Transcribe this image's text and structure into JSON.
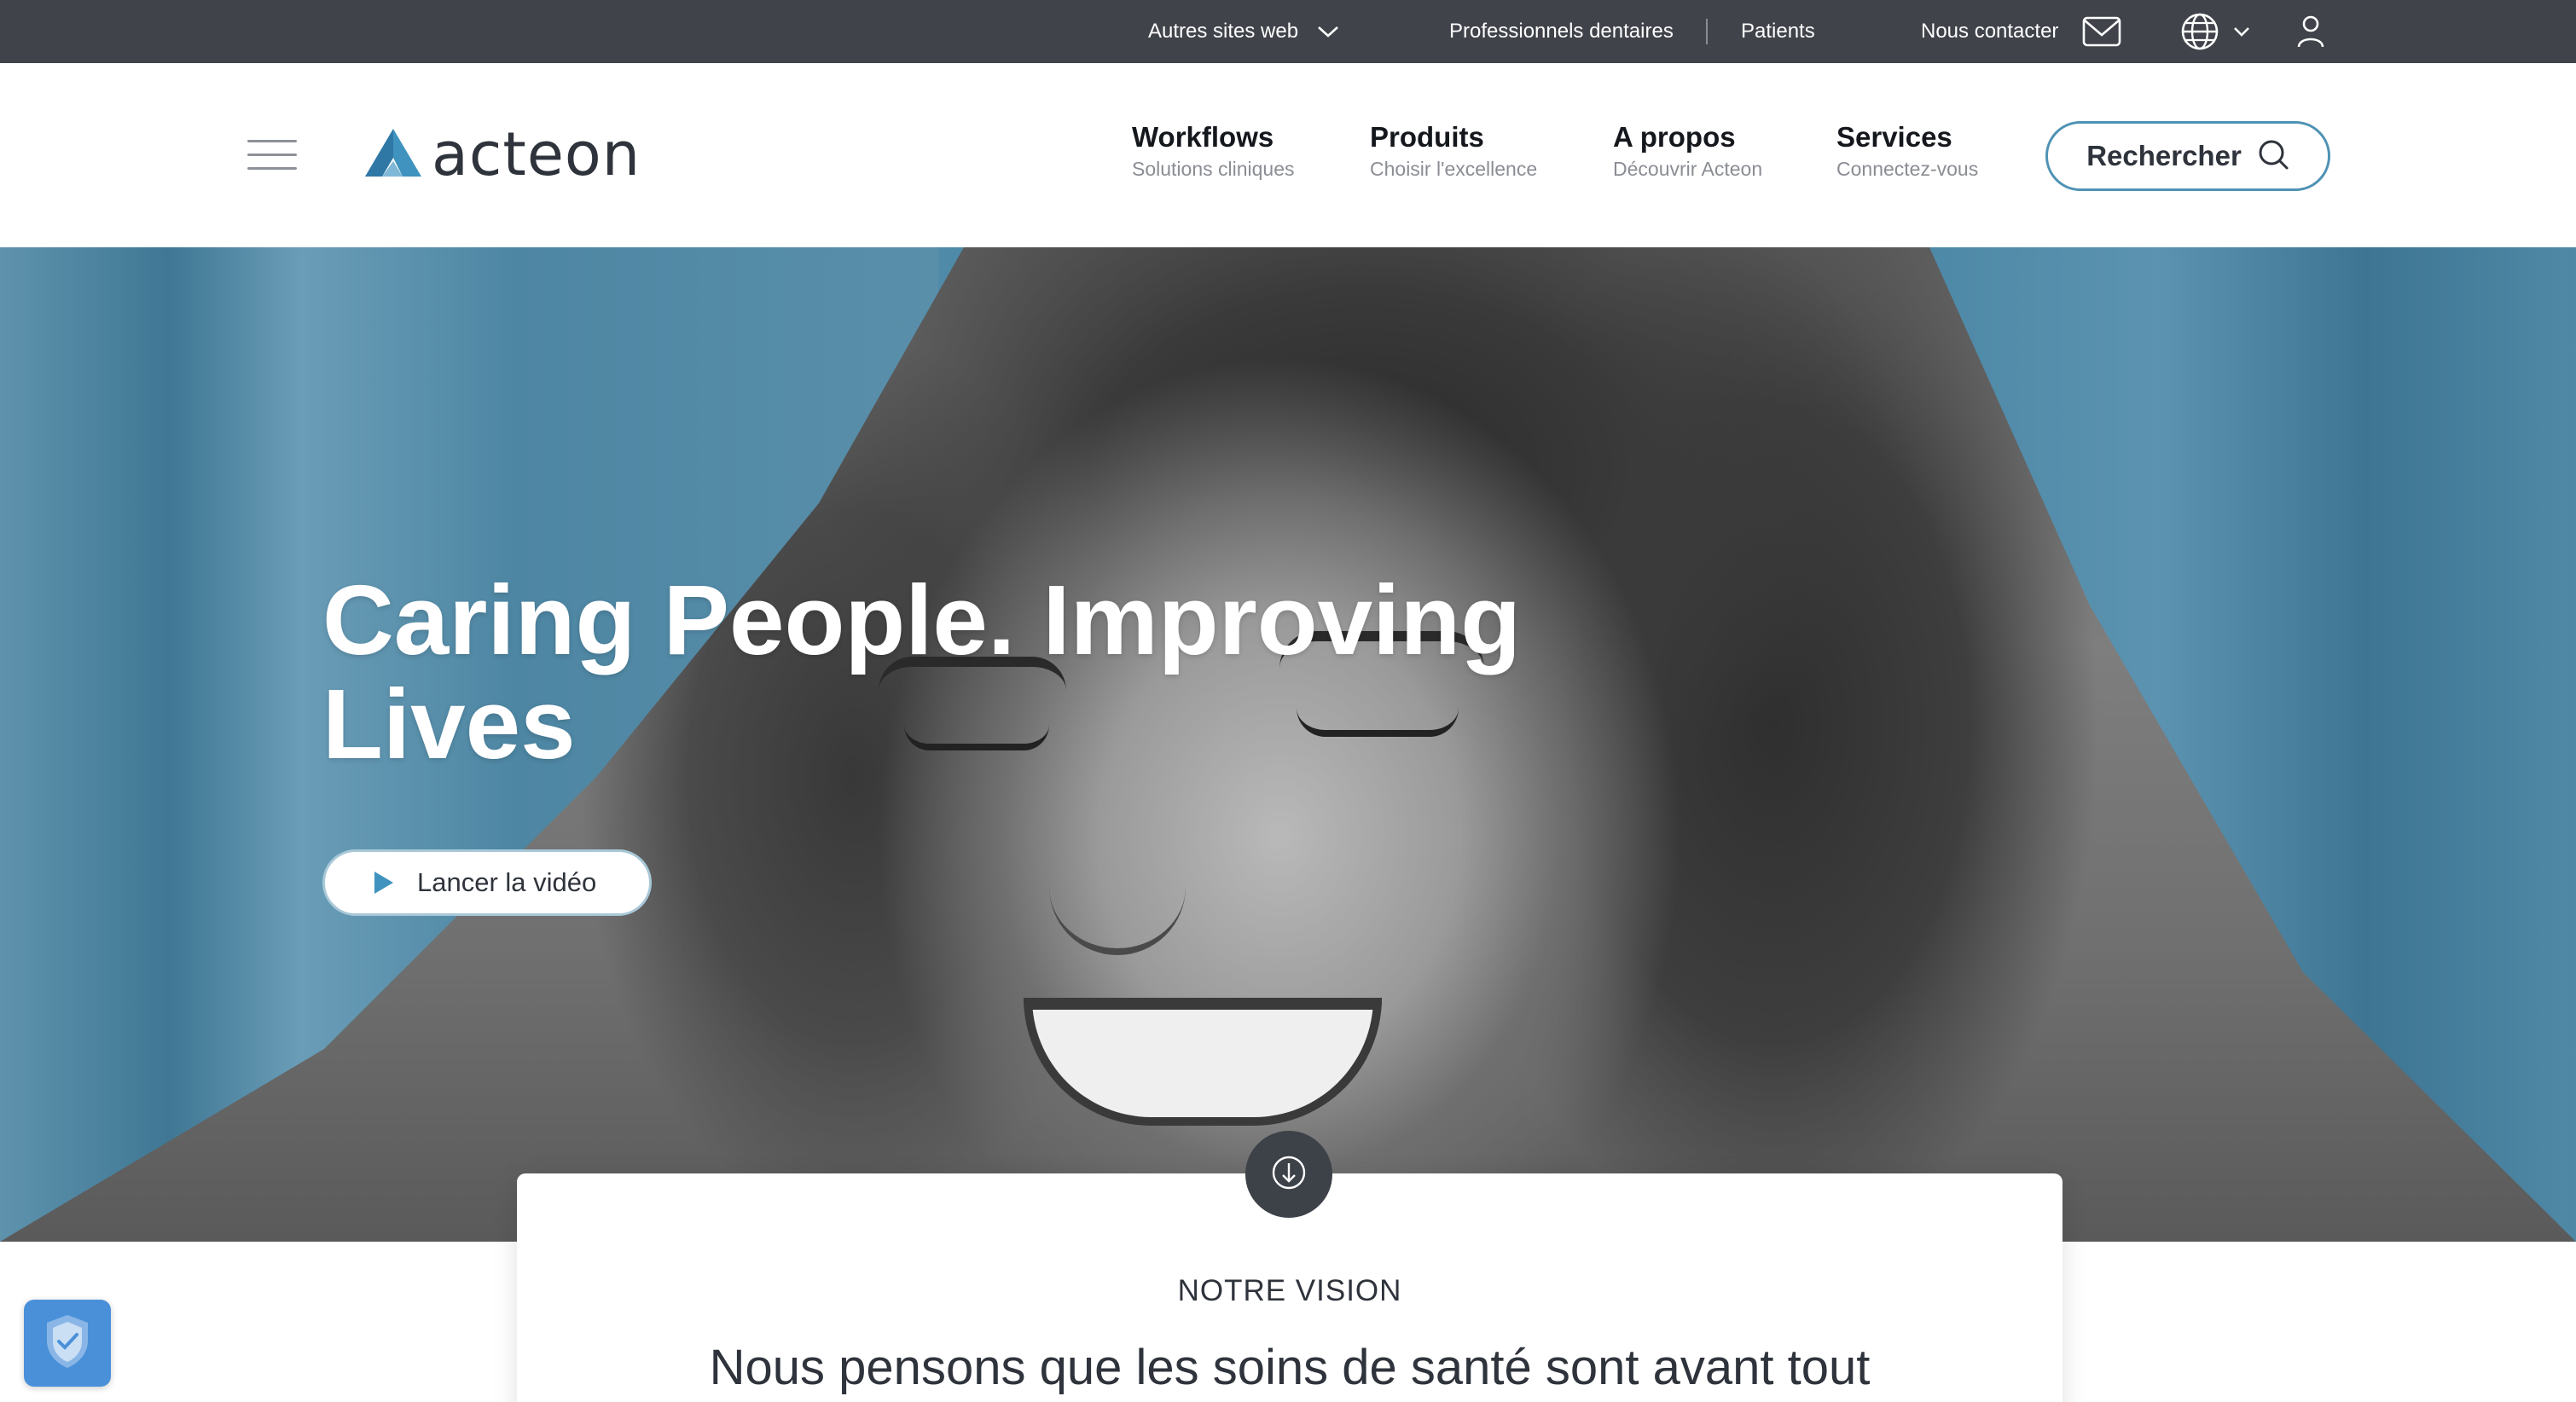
{
  "topbar": {
    "other_sites": "Autres sites web",
    "dental_pros": "Professionnels dentaires",
    "patients": "Patients",
    "contact": "Nous contacter"
  },
  "header": {
    "logo_text": "acteon",
    "nav": [
      {
        "title": "Workflows",
        "subtitle": "Solutions cliniques"
      },
      {
        "title": "Produits",
        "subtitle": "Choisir l'excellence"
      },
      {
        "title": "A propos",
        "subtitle": "Découvrir Acteon"
      },
      {
        "title": "Services",
        "subtitle": "Connectez-vous"
      }
    ],
    "search_label": "Rechercher"
  },
  "hero": {
    "title": "Caring People. Improving Lives",
    "video_button": "Lancer la vidéo"
  },
  "vision": {
    "label": "NOTRE VISION",
    "text": "Nous pensons que les soins de santé sont avant tout"
  },
  "colors": {
    "topbar_bg": "#40434a",
    "accent_blue": "#4e92b4",
    "hero_blue": "#4f8aa8",
    "logo_blue": "#3f93be"
  },
  "icons": {
    "other_sites_chevron": "chevron-down-icon",
    "contact": "mail-icon",
    "language": "globe-icon",
    "language_chevron": "chevron-down-icon",
    "account": "user-icon",
    "menu": "hamburger-menu-icon",
    "search": "search-icon",
    "play": "play-icon",
    "scroll": "arrow-down-circle-icon",
    "privacy": "shield-check-icon"
  }
}
